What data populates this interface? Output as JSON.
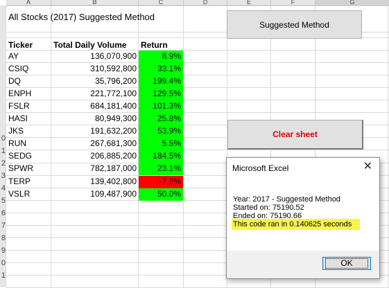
{
  "columns": [
    "A",
    "B",
    "C",
    "D",
    "E",
    "F",
    "G"
  ],
  "rows": [
    "",
    "",
    "",
    "",
    "",
    "",
    "",
    "",
    "",
    "",
    "0",
    "1",
    "2",
    "3",
    "4",
    "5",
    "6",
    "7",
    "8",
    "9",
    "0",
    "1"
  ],
  "sheet": {
    "title": "All Stocks (2017) Suggested Method",
    "headers": {
      "ticker": "Ticker",
      "volume": "Total Daily Volume",
      "return": "Return"
    },
    "records": [
      {
        "ticker": "AY",
        "volume": "136,070,900",
        "return": "8.9%"
      },
      {
        "ticker": "CSIQ",
        "volume": "310,592,800",
        "return": "33.1%"
      },
      {
        "ticker": "DQ",
        "volume": "35,796,200",
        "return": "199.4%"
      },
      {
        "ticker": "ENPH",
        "volume": "221,772,100",
        "return": "129.5%"
      },
      {
        "ticker": "FSLR",
        "volume": "684,181,400",
        "return": "101.3%"
      },
      {
        "ticker": "HASI",
        "volume": "80,949,300",
        "return": "25.8%"
      },
      {
        "ticker": "JKS",
        "volume": "191,632,200",
        "return": "53.9%"
      },
      {
        "ticker": "RUN",
        "volume": "267,681,300",
        "return": "5.5%"
      },
      {
        "ticker": "SEDG",
        "volume": "206,885,200",
        "return": "184.5%"
      },
      {
        "ticker": "SPWR",
        "volume": "782,187,000",
        "return": "23.1%"
      },
      {
        "ticker": "TERP",
        "volume": "139,402,800",
        "return": "-7.2%"
      },
      {
        "ticker": "VSLR",
        "volume": "109,487,900",
        "return": "50.0%"
      }
    ]
  },
  "buttons": {
    "suggested": "Suggested Method",
    "clear": "Clear sheet"
  },
  "dialog": {
    "title": "Microsoft Excel",
    "close_icon": "close-icon",
    "lines": [
      "Year: 2017 - Suggested Method",
      "Started on: 75190.52",
      "Ended on: 75190.66"
    ],
    "highlight": "This code ran in 0.140625 seconds",
    "ok": "OK"
  },
  "colors": {
    "positive": "#00ff00",
    "negative": "#ff0000",
    "highlight": "#f7f54a",
    "clear_text": "#e00000"
  }
}
